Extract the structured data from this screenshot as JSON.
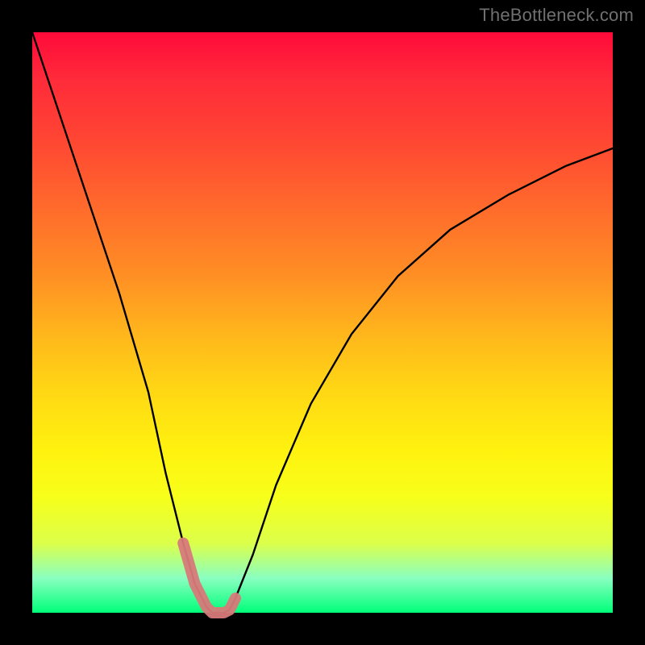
{
  "watermark": "TheBottleneck.com",
  "colors": {
    "frame": "#000000",
    "curve": "#000000",
    "highlight_stroke": "#d77a7a",
    "gradient_top": "#ff0a3a",
    "gradient_bottom": "#00ff7a"
  },
  "chart_data": {
    "type": "line",
    "title": "",
    "xlabel": "",
    "ylabel": "",
    "xlim": [
      0,
      100
    ],
    "ylim": [
      0,
      100
    ],
    "x": [
      0,
      5,
      10,
      15,
      20,
      23,
      26,
      28,
      30,
      31,
      32,
      33,
      34,
      35,
      38,
      42,
      48,
      55,
      63,
      72,
      82,
      92,
      100
    ],
    "series": [
      {
        "name": "bottleneck-curve",
        "values": [
          100,
          85,
          70,
          55,
          38,
          24,
          12,
          5,
          1,
          0,
          0,
          0,
          0.5,
          2.5,
          10,
          22,
          36,
          48,
          58,
          66,
          72,
          77,
          80
        ]
      }
    ],
    "highlight_segment": {
      "x": [
        26,
        28,
        30,
        31,
        32,
        33,
        34,
        35
      ],
      "values": [
        12,
        5,
        1,
        0,
        0,
        0,
        0.5,
        2.5
      ]
    }
  }
}
